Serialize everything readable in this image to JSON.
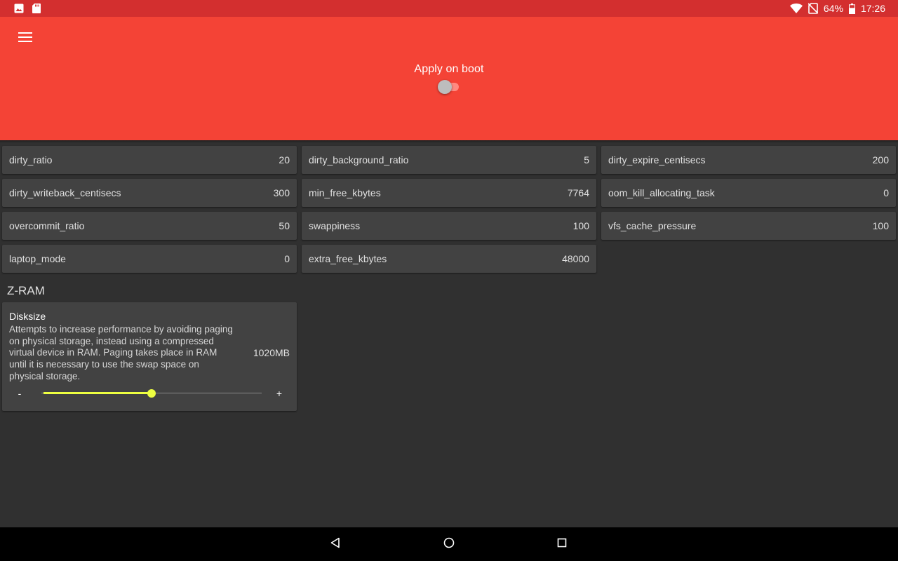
{
  "status_bar": {
    "left_icons": [
      "image-icon",
      "sd-card-icon"
    ],
    "right_icons": [
      "wifi-icon",
      "no-sim-icon",
      "battery-icon"
    ],
    "battery": "64%",
    "time": "17:26",
    "color": "#d32f2f"
  },
  "app_bar": {
    "color": "#f44336",
    "menu_icon": "hamburger-menu-icon",
    "apply_on_boot": {
      "label": "Apply on boot",
      "enabled": false
    }
  },
  "vm_params": [
    {
      "name": "dirty_ratio",
      "value": "20"
    },
    {
      "name": "dirty_background_ratio",
      "value": "5"
    },
    {
      "name": "dirty_expire_centisecs",
      "value": "200"
    },
    {
      "name": "dirty_writeback_centisecs",
      "value": "300"
    },
    {
      "name": "min_free_kbytes",
      "value": "7764"
    },
    {
      "name": "oom_kill_allocating_task",
      "value": "0"
    },
    {
      "name": "overcommit_ratio",
      "value": "50"
    },
    {
      "name": "swappiness",
      "value": "100"
    },
    {
      "name": "vfs_cache_pressure",
      "value": "100"
    },
    {
      "name": "laptop_mode",
      "value": "0"
    },
    {
      "name": "extra_free_kbytes",
      "value": "48000"
    }
  ],
  "zram": {
    "section_title": "Z-RAM",
    "title": "Disksize",
    "description": "Attempts to increase performance by avoiding paging on physical storage, instead using a compressed virtual device in RAM. Paging takes place in RAM until it is necessary to use the swap space on physical storage.",
    "value": "1020MB",
    "slider_fraction": 0.5,
    "minus_label": "-",
    "plus_label": "+",
    "accent_color": "#eeff41"
  },
  "nav_bar": {
    "buttons": [
      "back-icon",
      "home-icon",
      "recents-icon"
    ]
  }
}
